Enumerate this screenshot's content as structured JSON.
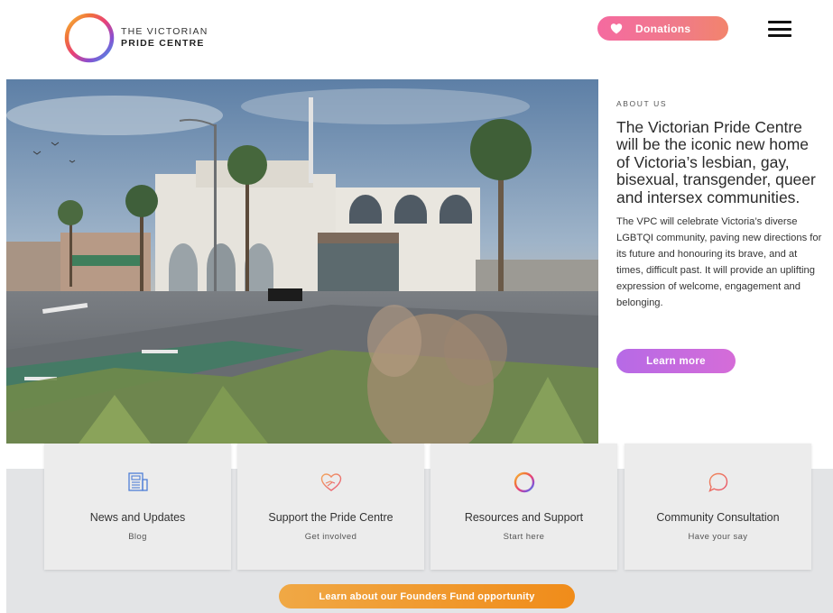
{
  "header": {
    "logo_line1": "THE VICTORIAN",
    "logo_line2": "PRIDE CENTRE",
    "donations_label": "Donations"
  },
  "about": {
    "kicker": "ABOUT US",
    "heading": "The Victorian Pride Centre will be the iconic new home of Victoria’s lesbian, gay, bisexual, transgender, queer and intersex communities.",
    "body": "The VPC will celebrate Victoria’s diverse LGBTQI community, paving new directions for its future and honouring its brave, and at times, difficult past. It will provide an uplifting expression of welcome, engagement and belonging.",
    "cta_label": "Learn more"
  },
  "cards": [
    {
      "icon": "newspaper-icon",
      "title": "News and Updates",
      "subtitle": "Blog"
    },
    {
      "icon": "heart-hand-icon",
      "title": "Support the Pride Centre",
      "subtitle": "Get involved"
    },
    {
      "icon": "rainbow-ring-icon",
      "title": "Resources and Support",
      "subtitle": "Start here"
    },
    {
      "icon": "speech-bubble-icon",
      "title": "Community Consultation",
      "subtitle": "Have your say"
    }
  ],
  "founders_cta": "Learn about our Founders Fund opportunity",
  "colors": {
    "donate_pink": "#f56aa0",
    "learn_purple": "#b66ae6",
    "fund_orange": "#f08c1a",
    "band_gray": "#e3e4e6"
  }
}
